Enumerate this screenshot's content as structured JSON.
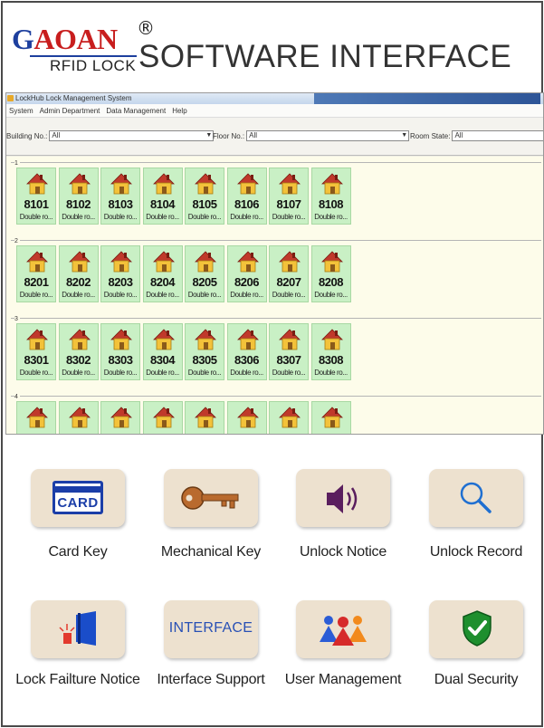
{
  "brand": {
    "name_first": "G",
    "name_rest": "AOAN",
    "registered_mark": "®",
    "subtitle": "RFID LOCK"
  },
  "headline": "SOFTWARE INTERFACE",
  "app_window": {
    "title": "LockHub Lock Management System",
    "menu": [
      "System",
      "Admin Department",
      "Data Management",
      "Help"
    ],
    "filters": {
      "building_label": "Building No.:",
      "building_value": "All",
      "floor_label": "Floor No.:",
      "floor_value": "All",
      "state_label": "Room State:",
      "state_value": "All"
    },
    "floors": [
      {
        "label": "1",
        "rooms": [
          {
            "number": "8101",
            "type": "Double ro..."
          },
          {
            "number": "8102",
            "type": "Double ro..."
          },
          {
            "number": "8103",
            "type": "Double ro..."
          },
          {
            "number": "8104",
            "type": "Double ro..."
          },
          {
            "number": "8105",
            "type": "Double ro..."
          },
          {
            "number": "8106",
            "type": "Double ro..."
          },
          {
            "number": "8107",
            "type": "Double ro..."
          },
          {
            "number": "8108",
            "type": "Double ro..."
          }
        ]
      },
      {
        "label": "2",
        "rooms": [
          {
            "number": "8201",
            "type": "Double ro..."
          },
          {
            "number": "8202",
            "type": "Double ro..."
          },
          {
            "number": "8203",
            "type": "Double ro..."
          },
          {
            "number": "8204",
            "type": "Double ro..."
          },
          {
            "number": "8205",
            "type": "Double ro..."
          },
          {
            "number": "8206",
            "type": "Double ro..."
          },
          {
            "number": "8207",
            "type": "Double ro..."
          },
          {
            "number": "8208",
            "type": "Double ro..."
          }
        ]
      },
      {
        "label": "3",
        "rooms": [
          {
            "number": "8301",
            "type": "Double ro..."
          },
          {
            "number": "8302",
            "type": "Double ro..."
          },
          {
            "number": "8303",
            "type": "Double ro..."
          },
          {
            "number": "8304",
            "type": "Double ro..."
          },
          {
            "number": "8305",
            "type": "Double ro..."
          },
          {
            "number": "8306",
            "type": "Double ro..."
          },
          {
            "number": "8307",
            "type": "Double ro..."
          },
          {
            "number": "8308",
            "type": "Double ro..."
          }
        ]
      },
      {
        "label": "4",
        "rooms": [
          {
            "number": "",
            "type": ""
          },
          {
            "number": "",
            "type": ""
          },
          {
            "number": "",
            "type": ""
          },
          {
            "number": "",
            "type": ""
          },
          {
            "number": "",
            "type": ""
          },
          {
            "number": "",
            "type": ""
          },
          {
            "number": "",
            "type": ""
          },
          {
            "number": "",
            "type": ""
          }
        ]
      }
    ]
  },
  "features": [
    {
      "label": "Card Key",
      "icon": "card-icon",
      "icon_text": "CARD"
    },
    {
      "label": "Mechanical Key",
      "icon": "key-icon"
    },
    {
      "label": "Unlock Notice",
      "icon": "speaker-icon"
    },
    {
      "label": "Unlock Record",
      "icon": "magnifier-icon"
    },
    {
      "label": "Lock Failture Notice",
      "icon": "door-alarm-icon"
    },
    {
      "label": "Interface Support",
      "icon": "interface-icon",
      "icon_text": "INTERFACE"
    },
    {
      "label": "User Management",
      "icon": "users-icon"
    },
    {
      "label": "Dual Security",
      "icon": "shield-check-icon"
    }
  ],
  "colors": {
    "brand_blue": "#1d3f9e",
    "brand_red": "#c81e1e",
    "room_green": "#c9f0c5",
    "tile_beige": "#ede1cf",
    "shield_green": "#1e8f2e"
  }
}
